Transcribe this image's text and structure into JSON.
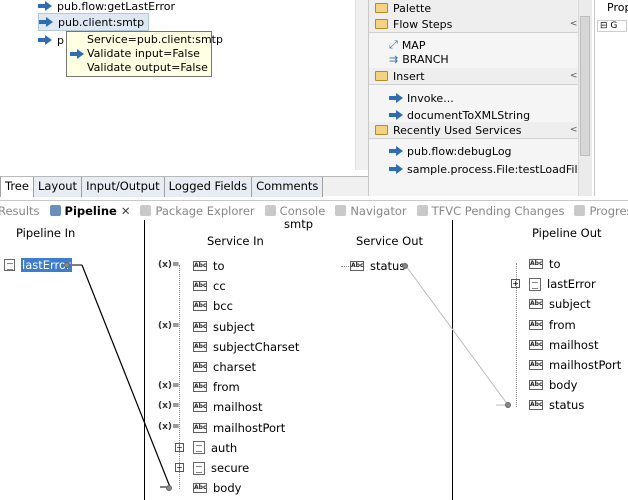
{
  "flow_tree": {
    "items": [
      {
        "label": "pub.flow:getLastError",
        "selected": false
      },
      {
        "label": "pub.client:smtp",
        "selected": true
      },
      {
        "label": "p",
        "selected": false
      }
    ]
  },
  "tooltip": {
    "lines": [
      "Service=pub.client:smtp",
      "Validate input=False",
      "Validate output=False"
    ]
  },
  "editor_tabs": [
    "Tree",
    "Layout",
    "Input/Output",
    "Logged Fields",
    "Comments"
  ],
  "palette": {
    "title": "Palette",
    "sections": [
      {
        "title": "Flow Steps",
        "items": [
          "MAP",
          "BRANCH"
        ]
      },
      {
        "title": "Insert",
        "items": [
          "Invoke...",
          "documentToXMLString"
        ]
      },
      {
        "title": "Recently Used Services",
        "items": [
          "pub.flow:debugLog",
          "sample.process.File:testLoadFile"
        ]
      }
    ]
  },
  "properties": {
    "title": "Prop"
  },
  "view_tabs": [
    {
      "label": "Results",
      "active": false
    },
    {
      "label": "Pipeline",
      "active": true
    },
    {
      "label": "Package Explorer",
      "active": false
    },
    {
      "label": "Console",
      "active": false
    },
    {
      "label": "Navigator",
      "active": false
    },
    {
      "label": "TFVC Pending Changes",
      "active": false
    },
    {
      "label": "Progress",
      "active": false
    }
  ],
  "pipeline": {
    "service_name": "smtp",
    "headers": {
      "pipeline_in": "Pipeline In",
      "service_in": "Service In",
      "service_out": "Service Out",
      "pipeline_out": "Pipeline Out"
    },
    "pipeline_in_fields": [
      "lastError"
    ],
    "service_in_fields": [
      {
        "name": "to",
        "type": "string"
      },
      {
        "name": "cc",
        "type": "string"
      },
      {
        "name": "bcc",
        "type": "string"
      },
      {
        "name": "subject",
        "type": "string"
      },
      {
        "name": "subjectCharset",
        "type": "string"
      },
      {
        "name": "charset",
        "type": "string"
      },
      {
        "name": "from",
        "type": "string"
      },
      {
        "name": "mailhost",
        "type": "string"
      },
      {
        "name": "mailhostPort",
        "type": "string"
      },
      {
        "name": "auth",
        "type": "document"
      },
      {
        "name": "secure",
        "type": "document"
      },
      {
        "name": "body",
        "type": "string"
      }
    ],
    "service_out_fields": [
      "status"
    ],
    "pipeline_out_fields": [
      "to",
      "lastError",
      "subject",
      "from",
      "mailhost",
      "mailhostPort",
      "body",
      "status"
    ]
  }
}
